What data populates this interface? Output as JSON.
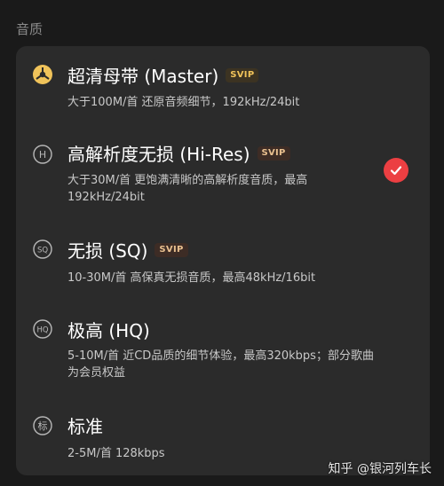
{
  "section_title": "音质",
  "options": [
    {
      "title": "超清母带 (Master)",
      "badge": "SVIP",
      "desc": "大于100M/首 还原音频细节，192kHz/24bit",
      "icon": "master-disc-icon",
      "selected": false
    },
    {
      "title": "高解析度无损 (Hi-Res)",
      "badge": "SVIP",
      "desc": "大于30M/首 更饱满清晰的高解析度音质，最高192kHz/24bit",
      "icon": "hi-res-icon",
      "selected": true
    },
    {
      "title": "无损 (SQ)",
      "badge": "SVIP",
      "desc": "10-30M/首 高保真无损音质，最高48kHz/16bit",
      "icon": "sq-icon",
      "selected": false
    },
    {
      "title": "极高 (HQ)",
      "badge": "",
      "desc": "5-10M/首 近CD品质的细节体验，最高320kbps；部分歌曲为会员权益",
      "icon": "hq-icon",
      "selected": false
    },
    {
      "title": "标准",
      "badge": "",
      "desc": "2-5M/首 128kbps",
      "icon": "standard-icon",
      "selected": false
    }
  ],
  "icon_glyphs": {
    "hi_res": "H",
    "sq": "SQ",
    "hq": "HQ",
    "standard": "标"
  },
  "colors": {
    "accent": "#ec3f42",
    "badge_gold": "#f0c35a",
    "card_bg": "#2b2b2b"
  },
  "watermark": "知乎 @银河列车长"
}
